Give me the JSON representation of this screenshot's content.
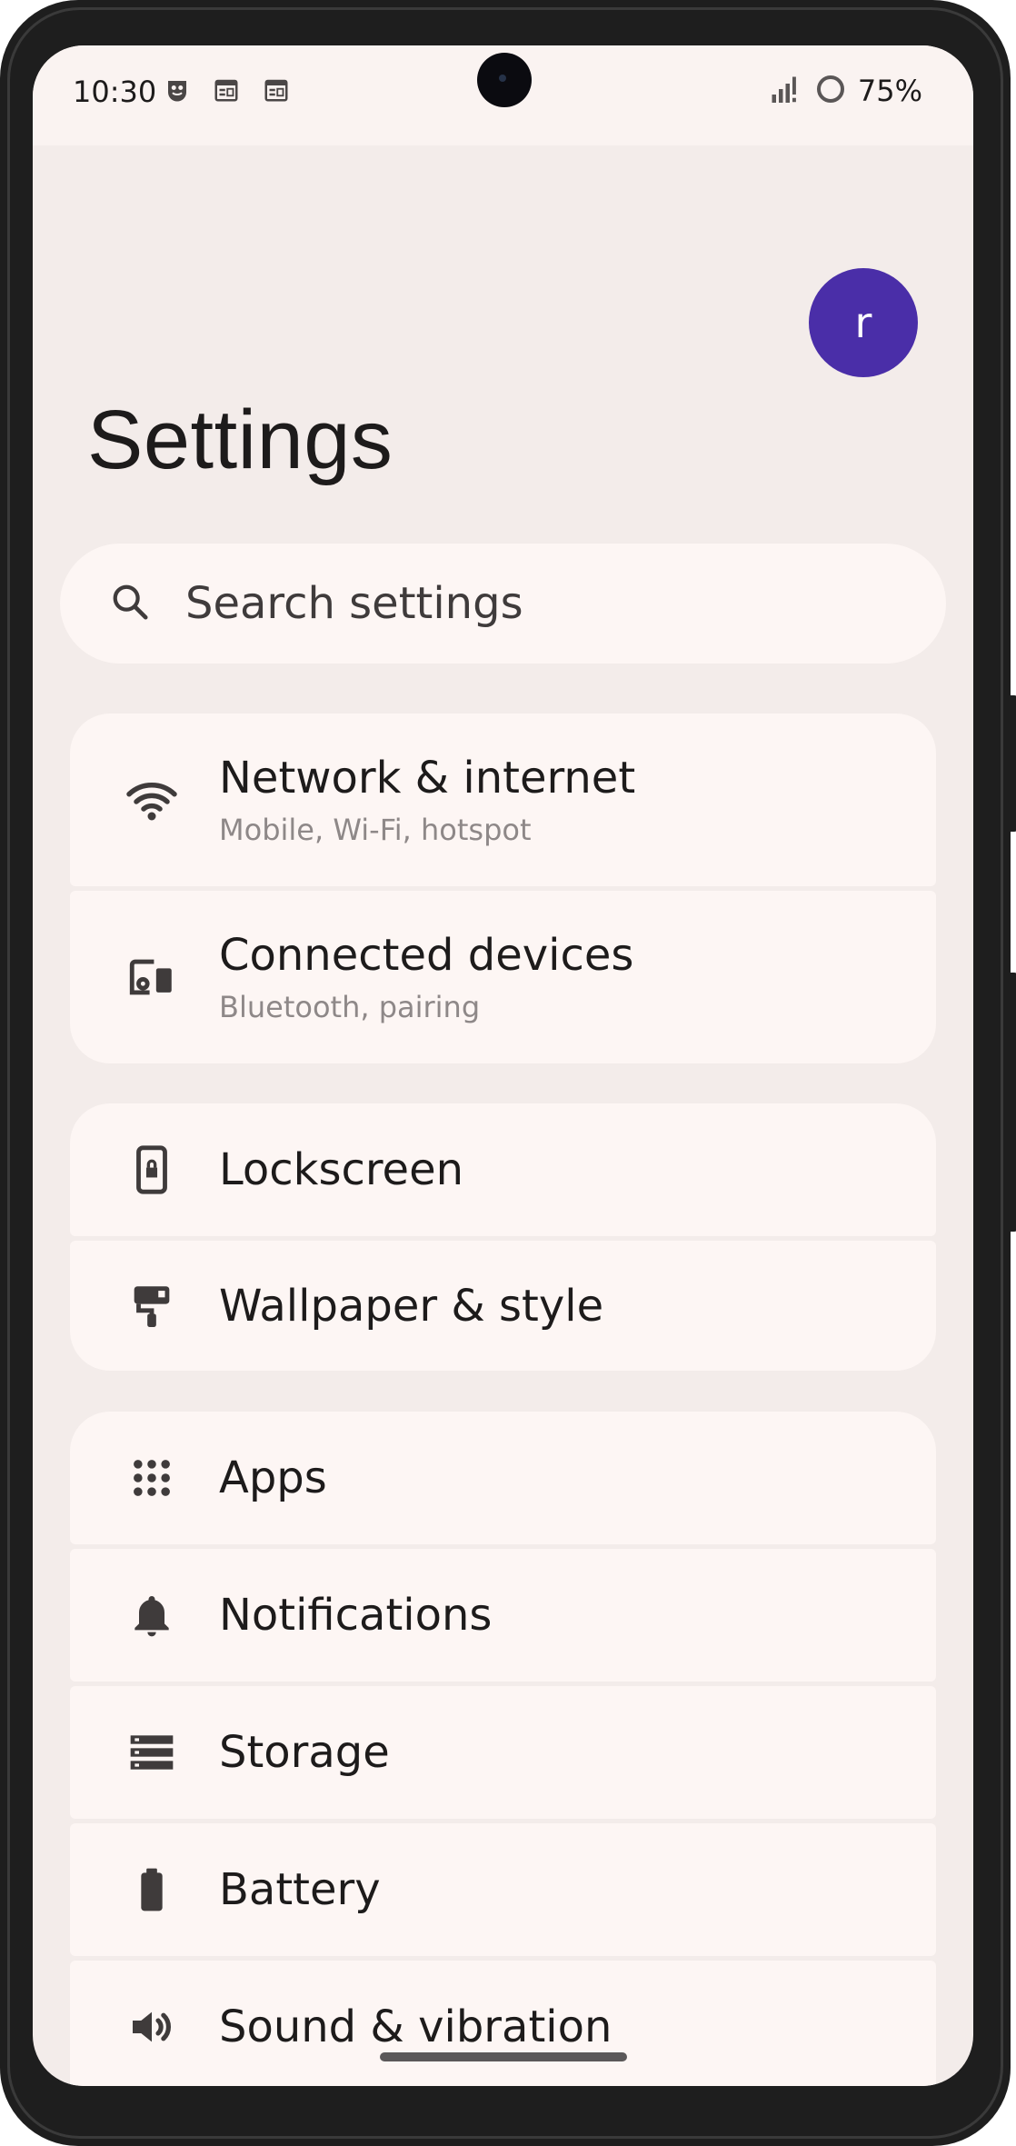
{
  "status_bar": {
    "time": "10:30",
    "battery_percent": "75%",
    "notification_icons": [
      "app-notification-icon",
      "calendar-icon",
      "calendar-icon"
    ],
    "signal_icon": "cell-signal-icon",
    "battery_icon": "battery-ring-icon"
  },
  "header": {
    "avatar_initial": "r",
    "title": "Settings"
  },
  "search": {
    "placeholder": "Search settings"
  },
  "groups": [
    {
      "items": [
        {
          "icon": "wifi-icon",
          "label": "Network & internet",
          "summary": "Mobile, Wi-Fi, hotspot"
        },
        {
          "icon": "devices-icon",
          "label": "Connected devices",
          "summary": "Bluetooth, pairing"
        }
      ]
    },
    {
      "items": [
        {
          "icon": "lock-icon",
          "label": "Lockscreen"
        },
        {
          "icon": "paint-roller-icon",
          "label": "Wallpaper & style"
        }
      ]
    },
    {
      "items": [
        {
          "icon": "apps-grid-icon",
          "label": "Apps"
        },
        {
          "icon": "bell-icon",
          "label": "Notifications"
        },
        {
          "icon": "storage-icon",
          "label": "Storage"
        },
        {
          "icon": "battery-icon",
          "label": "Battery"
        },
        {
          "icon": "speaker-icon",
          "label": "Sound & vibration"
        }
      ]
    }
  ],
  "colors": {
    "background": "#f3ecea",
    "card": "#fdf6f4",
    "avatar": "#4a2ea8",
    "text_primary": "#1d1b1b",
    "text_secondary": "#8e8888"
  }
}
